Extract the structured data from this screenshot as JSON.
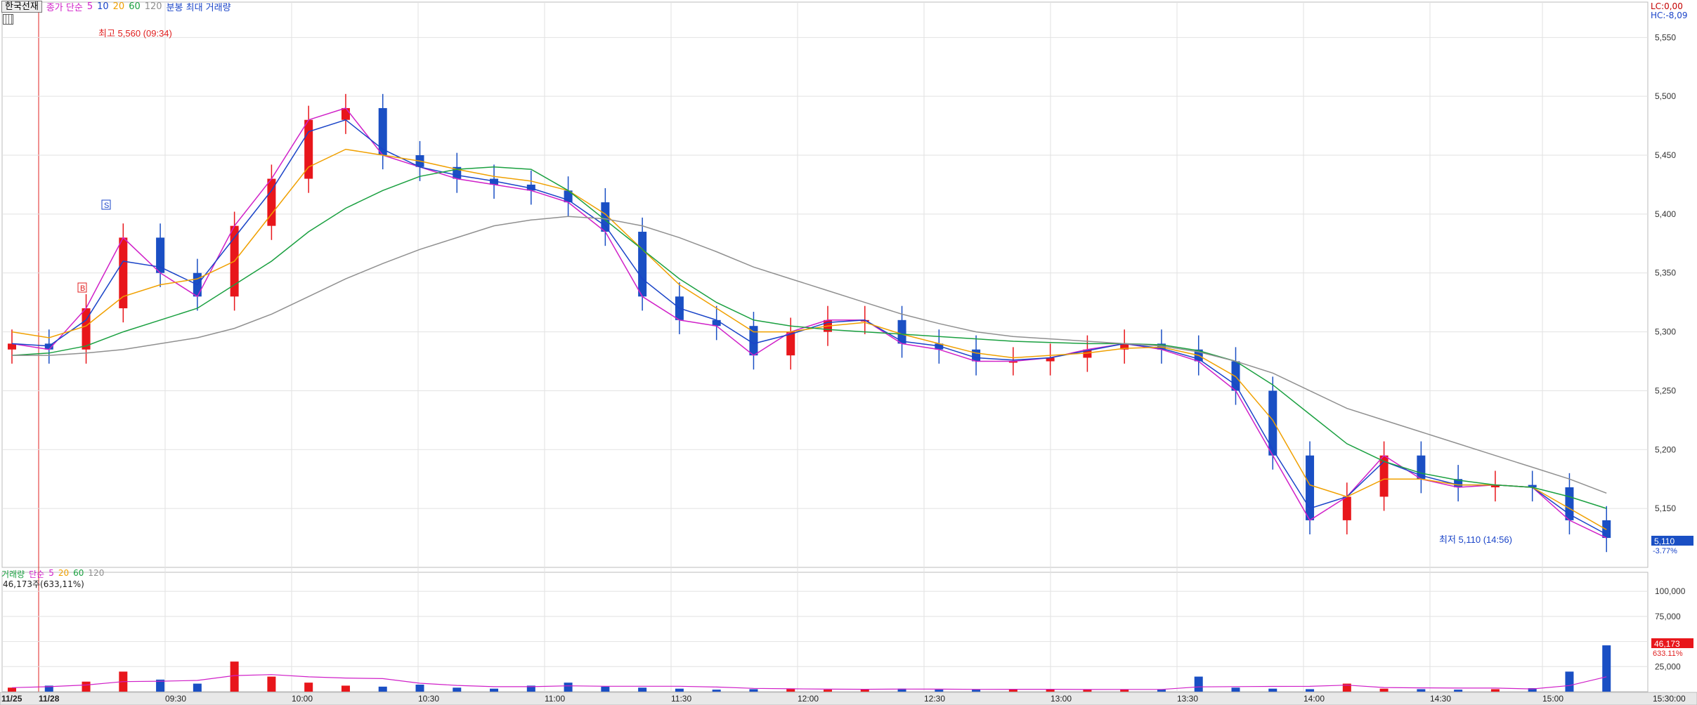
{
  "toolbar": {
    "symbol": "한국선재",
    "ma_label": "종가 단순",
    "ma_periods": [
      "5",
      "10",
      "20",
      "60",
      "120"
    ],
    "extra": "분봉 최대 거래량",
    "grid_icon": "grid-icon"
  },
  "price_info": {
    "lc": "LC:0,00",
    "hc": "HC:-8,09"
  },
  "annotations": {
    "high": "최고 5,560 (09:34)",
    "low": "최저 5,110 (14:56)",
    "current_price": "5,110",
    "current_change": "-3.77%",
    "marker_s": "S",
    "marker_b": "B"
  },
  "volume_panel": {
    "legend_title": "거래량",
    "legend_ma": "단순",
    "legend_periods": [
      "5",
      "20",
      "60",
      "120"
    ],
    "info": "46,173주(633,11%)",
    "current_volume": "46,173",
    "current_ratio": "633.11%"
  },
  "colors": {
    "up": "#e8161b",
    "down": "#1a4fc4",
    "ma5": "#d020c8",
    "ma10": "#1a44c8",
    "ma20": "#f0a000",
    "ma60": "#1aa040",
    "ma120": "#909090"
  },
  "chart_data": [
    {
      "type": "candlestick",
      "title": "한국선재",
      "ylim": [
        5100,
        5580
      ],
      "y_ticks": [
        "5,150",
        "5,200",
        "5,250",
        "5,300",
        "5,350",
        "5,400",
        "5,450",
        "5,500",
        "5,550"
      ],
      "x_tick_labels": [
        "11/25",
        "11/28",
        "09:30",
        "10:00",
        "10:30",
        "11:00",
        "11:30",
        "12:00",
        "12:30",
        "13:00",
        "13:30",
        "14:00",
        "14:30",
        "15:00",
        "15:30:00"
      ],
      "series": [
        {
          "name": "5",
          "values": [
            5290,
            5285,
            5320,
            5380,
            5350,
            5330,
            5390,
            5430,
            5480,
            5490,
            5450,
            5440,
            5430,
            5425,
            5420,
            5410,
            5385,
            5330,
            5310,
            5305,
            5280,
            5300,
            5310,
            5310,
            5290,
            5285,
            5275,
            5275,
            5278,
            5285,
            5290,
            5285,
            5275,
            5250,
            5195,
            5140,
            5160,
            5195,
            5175,
            5168,
            5170,
            5168,
            5140,
            5125
          ]
        },
        {
          "name": "10",
          "values": [
            5290,
            5288,
            5310,
            5360,
            5355,
            5340,
            5380,
            5420,
            5470,
            5480,
            5455,
            5440,
            5433,
            5428,
            5422,
            5412,
            5390,
            5345,
            5320,
            5310,
            5290,
            5298,
            5308,
            5310,
            5292,
            5288,
            5278,
            5276,
            5278,
            5284,
            5290,
            5286,
            5277,
            5255,
            5200,
            5150,
            5160,
            5190,
            5178,
            5170,
            5170,
            5168,
            5145,
            5128
          ]
        },
        {
          "name": "20",
          "values": [
            5300,
            5295,
            5305,
            5330,
            5340,
            5345,
            5360,
            5400,
            5440,
            5455,
            5450,
            5445,
            5438,
            5432,
            5428,
            5420,
            5400,
            5370,
            5340,
            5320,
            5300,
            5300,
            5305,
            5308,
            5298,
            5290,
            5282,
            5278,
            5280,
            5282,
            5286,
            5287,
            5280,
            5262,
            5225,
            5170,
            5160,
            5175,
            5175,
            5170,
            5170,
            5168,
            5150,
            5132
          ]
        },
        {
          "name": "60",
          "values": [
            5280,
            5282,
            5288,
            5300,
            5310,
            5320,
            5340,
            5360,
            5385,
            5405,
            5420,
            5432,
            5438,
            5440,
            5438,
            5420,
            5395,
            5370,
            5345,
            5325,
            5310,
            5305,
            5302,
            5300,
            5298,
            5296,
            5294,
            5292,
            5291,
            5290,
            5290,
            5289,
            5284,
            5275,
            5255,
            5230,
            5205,
            5190,
            5180,
            5174,
            5170,
            5168,
            5160,
            5150
          ]
        },
        {
          "name": "120",
          "values": [
            5280,
            5280,
            5282,
            5285,
            5290,
            5295,
            5303,
            5315,
            5330,
            5345,
            5358,
            5370,
            5380,
            5390,
            5395,
            5398,
            5396,
            5390,
            5380,
            5368,
            5355,
            5345,
            5335,
            5325,
            5315,
            5307,
            5300,
            5296,
            5294,
            5292,
            5290,
            5288,
            5283,
            5275,
            5265,
            5250,
            5235,
            5225,
            5215,
            5205,
            5195,
            5185,
            5175,
            5163
          ]
        }
      ]
    },
    {
      "type": "bar",
      "title": "거래량",
      "ylim": [
        0,
        112000
      ],
      "y_ticks": [
        "25,000",
        "50,000",
        "75,000",
        "100,000"
      ],
      "values": [
        4000,
        6000,
        10000,
        20000,
        12000,
        8000,
        30000,
        15000,
        9000,
        6000,
        5000,
        7000,
        4000,
        3000,
        6000,
        9000,
        5000,
        4000,
        3000,
        2000,
        2500,
        3000,
        2000,
        2500,
        3000,
        2000,
        2000,
        2500,
        2500,
        2000,
        2200,
        2000,
        15000,
        4000,
        3000,
        2500,
        8000,
        3000,
        2500,
        2000,
        2500,
        3500,
        20000,
        46173
      ]
    }
  ]
}
